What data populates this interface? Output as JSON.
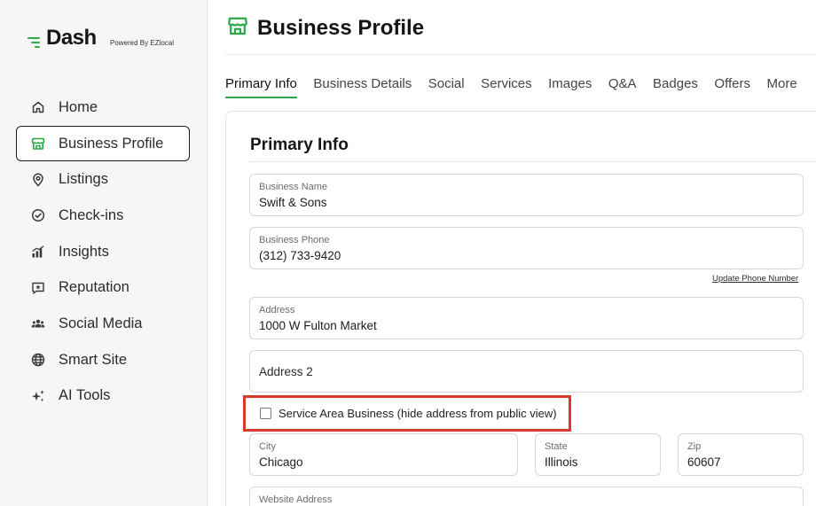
{
  "brand": {
    "name": "Dash",
    "powered_by": "Powered By EZlocal",
    "accent_color": "#2aa84a"
  },
  "sidebar": {
    "items": [
      {
        "label": "Home",
        "icon": "home-icon",
        "active": false
      },
      {
        "label": "Business Profile",
        "icon": "storefront-icon",
        "active": true
      },
      {
        "label": "Listings",
        "icon": "map-pin-icon",
        "active": false
      },
      {
        "label": "Check-ins",
        "icon": "check-circle-icon",
        "active": false
      },
      {
        "label": "Insights",
        "icon": "bar-chart-icon",
        "active": false
      },
      {
        "label": "Reputation",
        "icon": "star-message-icon",
        "active": false
      },
      {
        "label": "Social Media",
        "icon": "people-icon",
        "active": false
      },
      {
        "label": "Smart Site",
        "icon": "globe-icon",
        "active": false
      },
      {
        "label": "AI Tools",
        "icon": "sparkle-icon",
        "active": false
      }
    ]
  },
  "header": {
    "title": "Business Profile",
    "icon": "storefront-icon"
  },
  "tabs": [
    {
      "label": "Primary Info",
      "active": true
    },
    {
      "label": "Business Details",
      "active": false
    },
    {
      "label": "Social",
      "active": false
    },
    {
      "label": "Services",
      "active": false
    },
    {
      "label": "Images",
      "active": false
    },
    {
      "label": "Q&A",
      "active": false
    },
    {
      "label": "Badges",
      "active": false
    },
    {
      "label": "Offers",
      "active": false
    },
    {
      "label": "More",
      "active": false
    }
  ],
  "form": {
    "section_title": "Primary Info",
    "business_name": {
      "label": "Business Name",
      "value": "Swift & Sons"
    },
    "business_phone": {
      "label": "Business Phone",
      "value": "(312) 733-9420"
    },
    "update_phone_link": "Update Phone Number",
    "address": {
      "label": "Address",
      "value": "1000 W Fulton Market"
    },
    "address2": {
      "placeholder": "Address 2"
    },
    "service_area": {
      "label": "Service Area Business (hide address from public view)",
      "checked": false
    },
    "city": {
      "label": "City",
      "value": "Chicago"
    },
    "state": {
      "label": "State",
      "value": "Illinois"
    },
    "zip": {
      "label": "Zip",
      "value": "60607"
    },
    "website": {
      "label": "Website Address"
    }
  }
}
